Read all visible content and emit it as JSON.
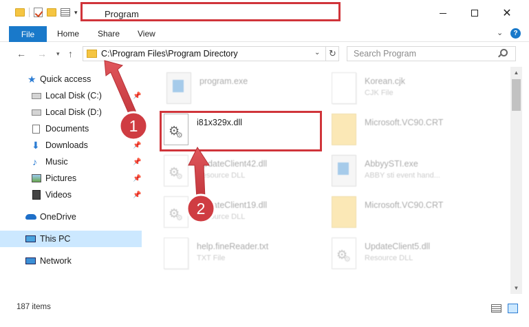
{
  "window": {
    "title": "Program"
  },
  "ribbon": {
    "tabs": [
      "File",
      "Home",
      "Share",
      "View"
    ]
  },
  "address": {
    "path": "C:\\Program Files\\Program Directory"
  },
  "search": {
    "placeholder": "Search Program"
  },
  "sidebar": {
    "items": [
      {
        "label": "Quick access",
        "icon": "star-icon"
      },
      {
        "label": "Local Disk (C:)",
        "icon": "disk-icon"
      },
      {
        "label": "Local Disk (D:)",
        "icon": "disk-icon"
      },
      {
        "label": "Documents",
        "icon": "documents-icon"
      },
      {
        "label": "Downloads",
        "icon": "download-icon"
      },
      {
        "label": "Music",
        "icon": "music-icon"
      },
      {
        "label": "Pictures",
        "icon": "pictures-icon"
      },
      {
        "label": "Videos",
        "icon": "videos-icon"
      },
      {
        "label": "OneDrive",
        "icon": "cloud-icon"
      },
      {
        "label": "This PC",
        "icon": "computer-icon"
      },
      {
        "label": "Network",
        "icon": "network-icon"
      }
    ]
  },
  "files": [
    {
      "name": "program.exe",
      "type": ""
    },
    {
      "name": "Korean.cjk",
      "type": "CJK File"
    },
    {
      "name": "i81x329x.dll",
      "type": ""
    },
    {
      "name": "Microsoft.VC90.CRT",
      "type": ""
    },
    {
      "name": "UpdateClient42.dll",
      "type": "Resource DLL"
    },
    {
      "name": "AbbyySTI.exe",
      "type": "ABBY sti event hand..."
    },
    {
      "name": "UpdateClient19.dll",
      "type": "Resource DLL"
    },
    {
      "name": "Microsoft.VC90.CRT",
      "type": ""
    },
    {
      "name": "help.fineReader.txt",
      "type": "TXT File"
    },
    {
      "name": "UpdateClient5.dll",
      "type": "Resource DLL"
    }
  ],
  "annotations": {
    "step1": "1",
    "step2": "2"
  },
  "status": {
    "item_count": "187 items"
  },
  "colors": {
    "accent": "#1979ca",
    "highlight": "#d0343a",
    "selection": "#cce8ff"
  }
}
